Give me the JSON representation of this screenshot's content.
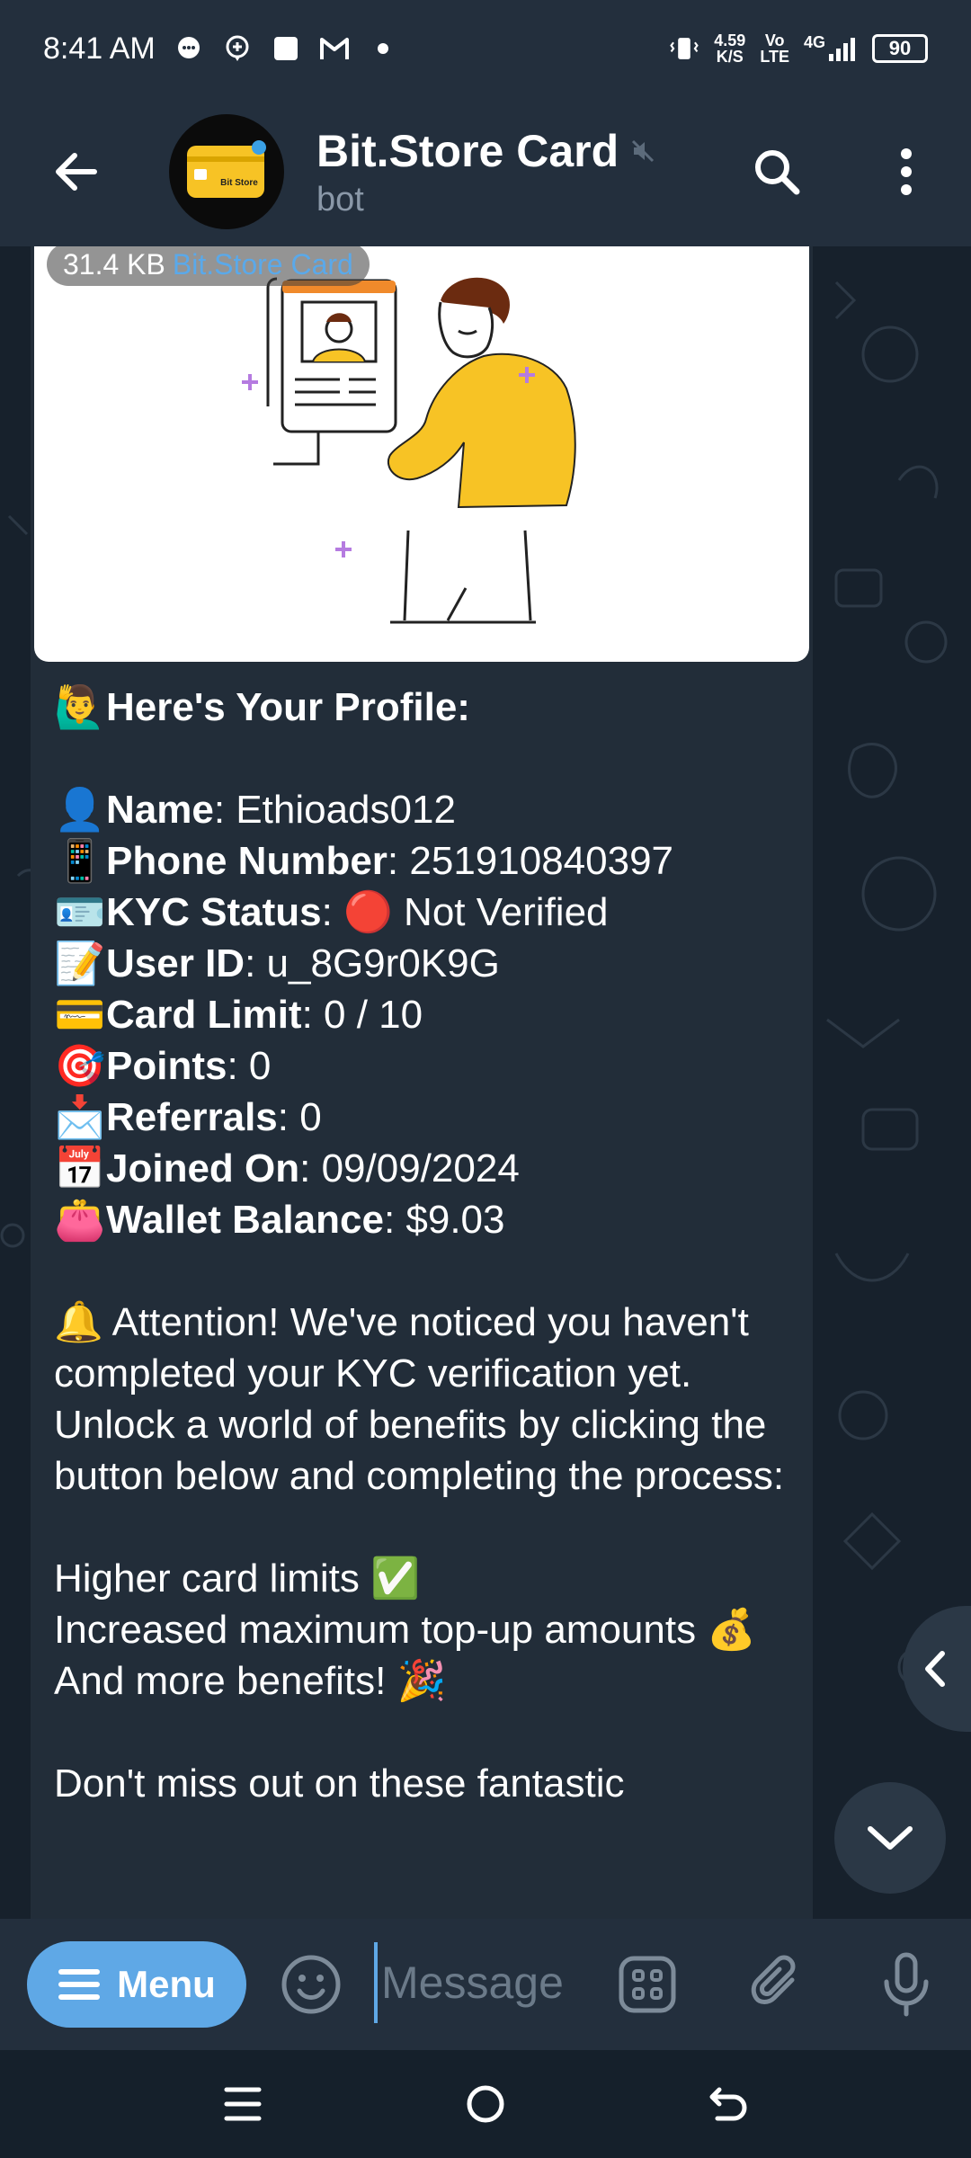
{
  "status_bar": {
    "time": "8:41 AM",
    "net_speed_value": "4.59",
    "net_speed_unit": "K/S",
    "volte_top": "Vo",
    "volte_bottom": "LTE",
    "network": "4G",
    "battery": "90"
  },
  "header": {
    "title": "Bit.Store Card",
    "subtitle": "bot",
    "avatar_text": "Bit Store"
  },
  "media": {
    "size": "31.4 KB",
    "caption_link": "Bit.Store Card"
  },
  "message": {
    "heading_emoji": "🙋‍♂️",
    "heading": "Here's Your Profile:",
    "fields": [
      {
        "emoji": "👤",
        "label": "Name",
        "value": ": Ethioads012"
      },
      {
        "emoji": "📱",
        "label": "Phone Number",
        "value": ": 251910840397"
      },
      {
        "emoji": "🪪",
        "label": "KYC Status",
        "value": ": 🔴 Not Verified"
      },
      {
        "emoji": "📝",
        "label": "User ID",
        "value": ": u_8G9r0K9G"
      },
      {
        "emoji": "💳",
        "label": "Card Limit",
        "value": ": 0 / 10"
      },
      {
        "emoji": "🎯",
        "label": "Points",
        "value": ": 0"
      },
      {
        "emoji": "📩",
        "label": "Referrals",
        "value": ": 0"
      },
      {
        "emoji": "📅",
        "label": "Joined On",
        "value": ": 09/09/2024"
      },
      {
        "emoji": "👛",
        "label": "Wallet Balance",
        "value": ": $9.03"
      }
    ],
    "attention": "🔔 Attention! We've noticed you haven't completed your KYC verification yet. Unlock a world of benefits by clicking the button below and completing the process:",
    "benefit1": "Higher card limits ✅",
    "benefit2": "Increased maximum top-up amounts 💰",
    "benefit3": "And more benefits! 🎉",
    "closing": "Don't miss out on these fantastic"
  },
  "composer": {
    "menu_label": "Menu",
    "placeholder": "Message"
  }
}
